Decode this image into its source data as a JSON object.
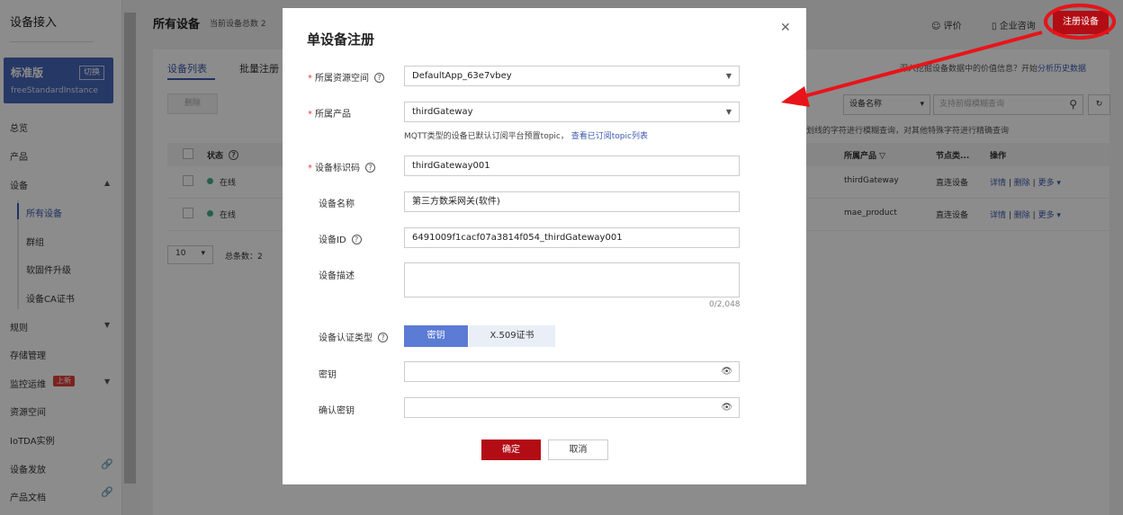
{
  "sidebar": {
    "title": "设备接入",
    "edition": "标准版",
    "switch_label": "切换",
    "instance": "freeStandardInstance",
    "items": {
      "overview": "总览",
      "product": "产品",
      "device": "设备",
      "all_devices": "所有设备",
      "groups": "群组",
      "firmware": "软固件升级",
      "ca": "设备CA证书",
      "rules": "规则",
      "storage": "存储管理",
      "monitor": "监控运维",
      "new_badge": "上新",
      "resource_space": "资源空间",
      "iotda": "IoTDA实例",
      "provisioning": "设备发放",
      "docs": "产品文档"
    }
  },
  "header": {
    "title": "所有设备",
    "count_label": "当前设备总数 2",
    "rate": "评价",
    "enterprise": "企业咨询",
    "register": "注册设备",
    "hint": "深入挖掘设备数据中的价值信息？开始",
    "hint_link": "分析历史数据"
  },
  "tabs": {
    "list": "设备列表",
    "batch": "批量注册"
  },
  "toolbar": {
    "delete": "删除",
    "filter_field": "设备名称",
    "search_placeholder": "支持前缀模糊查询",
    "search_tip": "划线的字符进行模糊查询，对其他特殊字符进行精确查询"
  },
  "table": {
    "headers": {
      "status": "状态",
      "product": "所属产品",
      "node_type": "节点类...",
      "ops": "操作"
    },
    "rows": [
      {
        "status": "在线",
        "product": "thirdGateway",
        "node": "直连设备",
        "detail": "详情",
        "delete": "删除",
        "more": "更多 ▾"
      },
      {
        "status": "在线",
        "product": "mae_product",
        "node": "直连设备",
        "detail": "详情",
        "delete": "删除",
        "more": "更多 ▾"
      }
    ],
    "page_size": "10",
    "total": "总条数：2"
  },
  "modal": {
    "title": "单设备注册",
    "space_label": "所属资源空间",
    "space_value": "DefaultApp_63e7vbey",
    "product_label": "所属产品",
    "product_value": "thirdGateway",
    "mqtt_note": "MQTT类型的设备已默认订阅平台预置topic，",
    "mqtt_link": "查看已订阅topic列表",
    "node_id_label": "设备标识码",
    "node_id_value": "thirdGateway001",
    "name_label": "设备名称",
    "name_value": "第三方数采网关(软件)",
    "device_id_label": "设备ID",
    "device_id_value": "6491009f1cacf07a3814f054_thirdGateway001",
    "desc_label": "设备描述",
    "desc_counter": "0/2,048",
    "auth_label": "设备认证类型",
    "auth_secret": "密钥",
    "auth_x509": "X.509证书",
    "secret_label": "密钥",
    "confirm_label": "确认密钥",
    "ok": "确定",
    "cancel": "取消"
  },
  "colors": {
    "accent": "#3b5ab0",
    "primary_red": "#b20d15",
    "annotation_red": "#e8141a"
  }
}
